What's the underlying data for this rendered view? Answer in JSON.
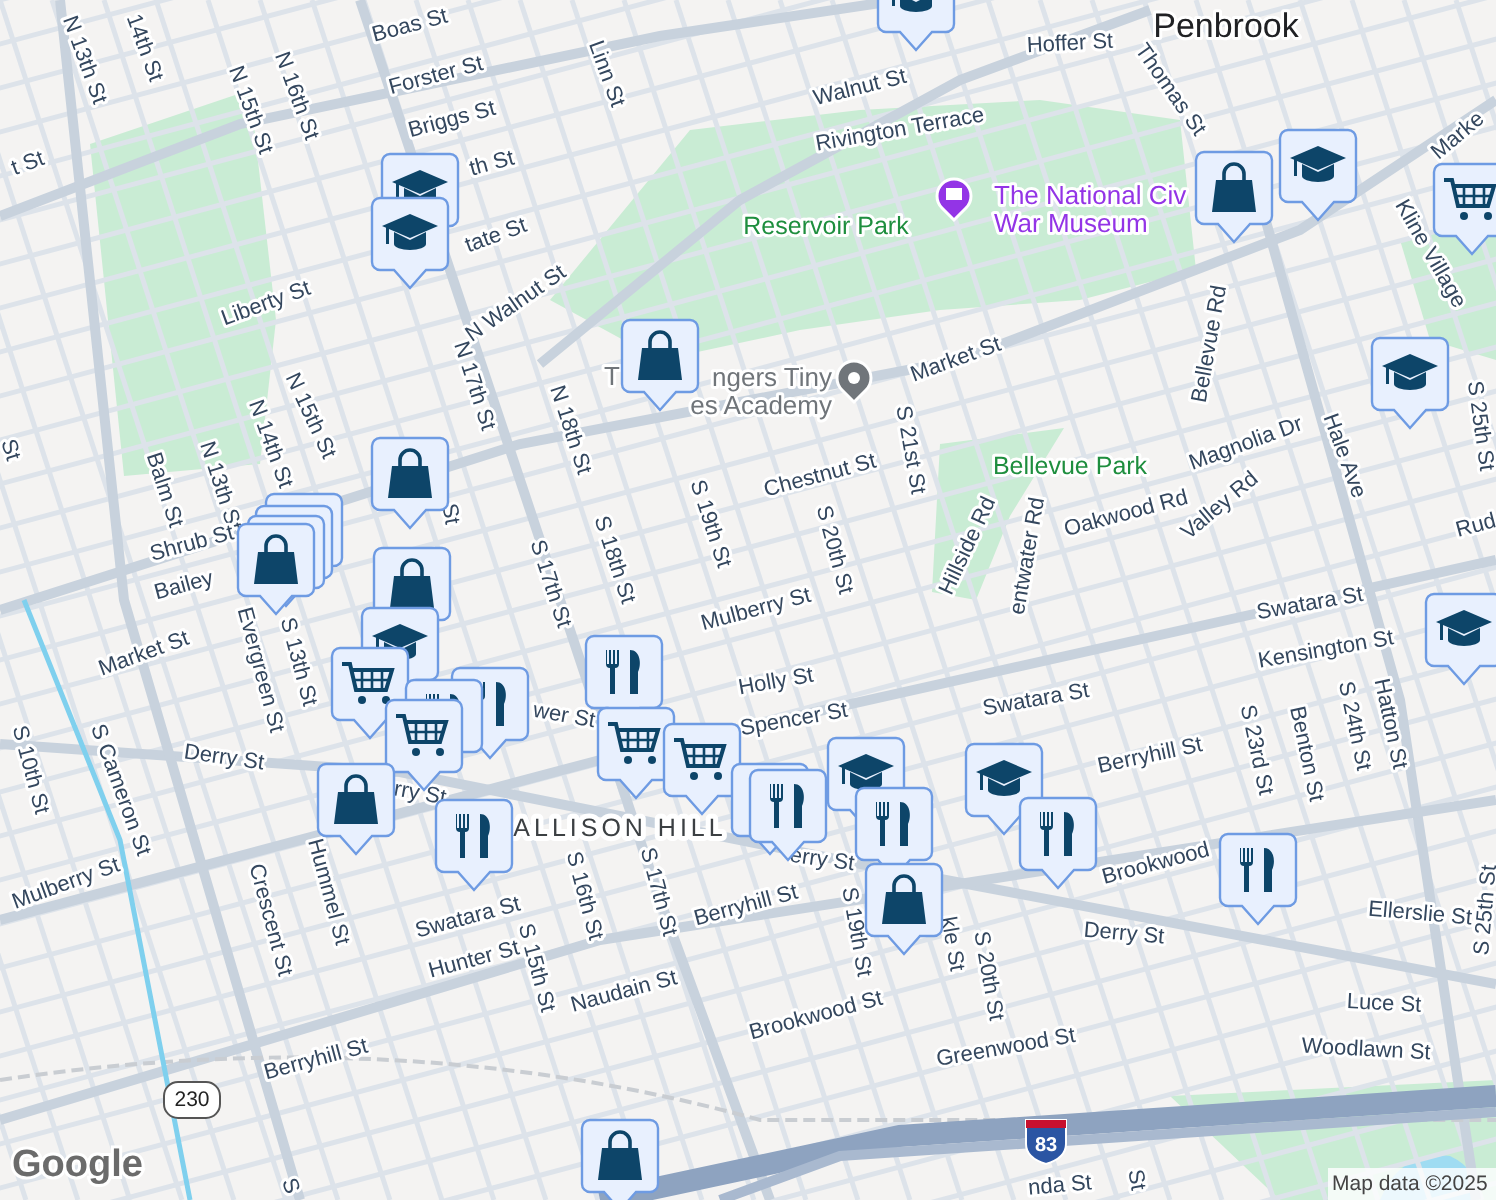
{
  "map": {
    "labels": [
      {
        "text": "t St",
        "kind": "street"
      },
      {
        "text": "N 13th St",
        "kind": "street"
      },
      {
        "text": "14th St",
        "kind": "street"
      },
      {
        "text": "Boas St",
        "kind": "street"
      },
      {
        "text": "Forster St",
        "kind": "street"
      },
      {
        "text": "Briggs St",
        "kind": "street"
      },
      {
        "text": "th St",
        "kind": "street"
      },
      {
        "text": "N 15th St",
        "kind": "street"
      },
      {
        "text": "N 16th St",
        "kind": "street"
      },
      {
        "text": "Linn St",
        "kind": "street"
      },
      {
        "text": "tate St",
        "kind": "street"
      },
      {
        "text": "Liberty St",
        "kind": "street"
      },
      {
        "text": "N Walnut St",
        "kind": "street"
      },
      {
        "text": "N 17th St",
        "kind": "street"
      },
      {
        "text": "N 18th St",
        "kind": "street"
      },
      {
        "text": "N 15th St",
        "kind": "street"
      },
      {
        "text": "N 14th St",
        "kind": "street"
      },
      {
        "text": "N 13th St",
        "kind": "street"
      },
      {
        "text": "Balm St",
        "kind": "street"
      },
      {
        "text": "Shrub St",
        "kind": "street"
      },
      {
        "text": "Bailey",
        "kind": "street"
      },
      {
        "text": "St",
        "kind": "street"
      },
      {
        "text": "S 17th St",
        "kind": "street"
      },
      {
        "text": "S 18th St",
        "kind": "street"
      },
      {
        "text": "S 19th St",
        "kind": "street"
      },
      {
        "text": "St",
        "kind": "street"
      },
      {
        "text": "Penbrook",
        "kind": "town"
      },
      {
        "text": "Hoffer St",
        "kind": "street"
      },
      {
        "text": "Walnut St",
        "kind": "street"
      },
      {
        "text": "Rivington Terrace",
        "kind": "street"
      },
      {
        "text": "Thomas St",
        "kind": "street"
      },
      {
        "text": "Reservoir Park",
        "kind": "park"
      },
      {
        "lines": [
          "The National Civ",
          "War Museum"
        ],
        "kind": "poi",
        "color": "#9334e6"
      },
      {
        "text": "Marke",
        "kind": "street"
      },
      {
        "text": "Kline Village",
        "kind": "street"
      },
      {
        "text": "Bellevue Rd",
        "kind": "street"
      },
      {
        "text": "Market St",
        "kind": "street"
      },
      {
        "text": "T",
        "kind": "poi_text"
      },
      {
        "lines": [
          "ngers Tiny",
          "es Academy"
        ],
        "kind": "poi",
        "color": "#70757a"
      },
      {
        "text": "S 21st St",
        "kind": "street"
      },
      {
        "text": "Chestnut St",
        "kind": "street"
      },
      {
        "text": "S 20th St",
        "kind": "street"
      },
      {
        "text": "Bellevue Park",
        "kind": "park"
      },
      {
        "text": "Magnolia Dr",
        "kind": "street"
      },
      {
        "text": "Oakwood Rd",
        "kind": "street"
      },
      {
        "text": "Valley Rd",
        "kind": "street"
      },
      {
        "text": "Hillside Rd",
        "kind": "street"
      },
      {
        "text": "entwater Rd",
        "kind": "street"
      },
      {
        "text": "Hale Ave",
        "kind": "street"
      },
      {
        "text": "S 25th St",
        "kind": "street"
      },
      {
        "text": "Rud",
        "kind": "street"
      },
      {
        "text": "Mulberry St",
        "kind": "street"
      },
      {
        "text": "Swatara St",
        "kind": "street"
      },
      {
        "text": "Kensington St",
        "kind": "street"
      },
      {
        "text": "Holly St",
        "kind": "street"
      },
      {
        "text": "Spencer St",
        "kind": "street"
      },
      {
        "text": "Swatara St",
        "kind": "street"
      },
      {
        "text": "Berryhill St",
        "kind": "street"
      },
      {
        "text": "S 23rd St",
        "kind": "street"
      },
      {
        "text": "Benton St",
        "kind": "street"
      },
      {
        "text": "S 24th St",
        "kind": "street"
      },
      {
        "text": "Hatton St",
        "kind": "street"
      },
      {
        "text": "S 25th St",
        "kind": "street"
      },
      {
        "text": "Brookwood",
        "kind": "street"
      },
      {
        "text": "Ellerslie St",
        "kind": "street"
      },
      {
        "text": "Derry St",
        "kind": "street"
      },
      {
        "text": "erry St",
        "kind": "street"
      },
      {
        "text": "Berryhill St",
        "kind": "street"
      },
      {
        "text": "S 19th St",
        "kind": "street"
      },
      {
        "text": "kle St",
        "kind": "street"
      },
      {
        "text": "S 20th St",
        "kind": "street"
      },
      {
        "text": "Brookwood St",
        "kind": "street"
      },
      {
        "text": "Greenwood St",
        "kind": "street"
      },
      {
        "text": "Luce St",
        "kind": "street"
      },
      {
        "text": "Woodlawn St",
        "kind": "street"
      },
      {
        "text": "nda St",
        "kind": "street"
      },
      {
        "text": "St",
        "kind": "street"
      },
      {
        "text": "Market St",
        "kind": "street"
      },
      {
        "text": "Evergreen St",
        "kind": "street"
      },
      {
        "text": "S 13th St",
        "kind": "street"
      },
      {
        "text": "Derry St",
        "kind": "street"
      },
      {
        "text": "S Cameron St",
        "kind": "street"
      },
      {
        "text": "S 10th St",
        "kind": "street"
      },
      {
        "text": "Mulberry St",
        "kind": "street"
      },
      {
        "text": "Crescent St",
        "kind": "street"
      },
      {
        "text": "Hummel St",
        "kind": "street"
      },
      {
        "text": "Swatara St",
        "kind": "street"
      },
      {
        "text": "Hunter St",
        "kind": "street"
      },
      {
        "text": "S 15th St",
        "kind": "street"
      },
      {
        "text": "S 16th St",
        "kind": "street"
      },
      {
        "text": "S 17th St",
        "kind": "street"
      },
      {
        "text": "Naudain St",
        "kind": "street"
      },
      {
        "text": "Berryhill St",
        "kind": "street"
      },
      {
        "text": "ALLISON HILL",
        "kind": "district"
      },
      {
        "text": "rry St",
        "kind": "street"
      },
      {
        "text": "wer St",
        "kind": "street"
      },
      {
        "text": "S",
        "kind": "street"
      }
    ],
    "markers": [
      {
        "kind": "school"
      },
      {
        "kind": "school"
      },
      {
        "kind": "school"
      },
      {
        "kind": "shop"
      },
      {
        "kind": "shop"
      },
      {
        "kind": "grocery"
      },
      {
        "kind": "shop"
      },
      {
        "kind": "shop"
      },
      {
        "kind": "shop"
      },
      {
        "kind": "shop"
      },
      {
        "kind": "school"
      },
      {
        "kind": "grocery"
      },
      {
        "kind": "restaurant"
      },
      {
        "kind": "restaurant"
      },
      {
        "kind": "grocery"
      },
      {
        "kind": "restaurant"
      },
      {
        "kind": "grocery"
      },
      {
        "kind": "grocery"
      },
      {
        "kind": "shop"
      },
      {
        "kind": "restaurant"
      },
      {
        "kind": "restaurant"
      },
      {
        "kind": "restaurant"
      },
      {
        "kind": "school"
      },
      {
        "kind": "restaurant"
      },
      {
        "kind": "school"
      },
      {
        "kind": "restaurant"
      },
      {
        "kind": "shop"
      },
      {
        "kind": "restaurant"
      },
      {
        "kind": "school"
      },
      {
        "kind": "school"
      },
      {
        "kind": "grocery"
      },
      {
        "kind": "shop"
      },
      {
        "kind": "school"
      },
      {
        "kind": "shop"
      }
    ],
    "shields": [
      {
        "text": "230",
        "kind": "state"
      },
      {
        "text": "83",
        "kind": "interstate"
      }
    ],
    "logo": "Google",
    "attribution": "Map data ©2025"
  }
}
